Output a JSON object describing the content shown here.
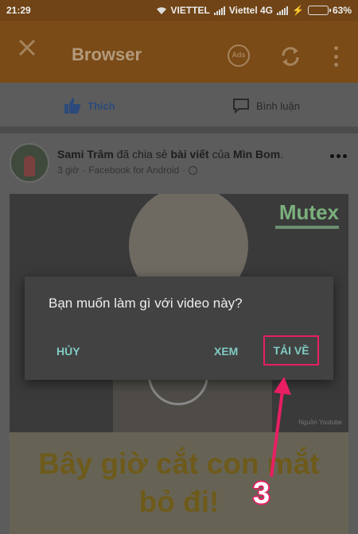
{
  "status_bar": {
    "time": "21:29",
    "carrier1": "VIETTEL",
    "carrier2": "Viettel 4G",
    "battery": "63%",
    "battery_level": 0.63
  },
  "toolbar": {
    "title": "Browser",
    "ads_label": "Ads",
    "icons": [
      "close-icon",
      "ads-icon",
      "refresh-icon",
      "more-vert-icon"
    ]
  },
  "actions": {
    "like": "Thích",
    "comment": "Bình luận"
  },
  "post": {
    "author": "Sami Trâm",
    "shared_text": "đã chia sẻ",
    "object": "bài viết",
    "of": "của",
    "original_author": "Mìn Bom",
    "time": "3 giờ",
    "app": "Facebook for Android",
    "video_brand": "Mutex",
    "video_source": "Nguồn Youtube",
    "caption_line1": "Bây giờ cắt con mắt",
    "caption_line2": "bỏ đi!"
  },
  "dialog": {
    "message": "Bạn muốn làm gì với video này?",
    "cancel": "HỦY",
    "view": "XEM",
    "download": "TẢI VỀ"
  },
  "annotation": {
    "step": "3",
    "color": "#e91e63"
  }
}
